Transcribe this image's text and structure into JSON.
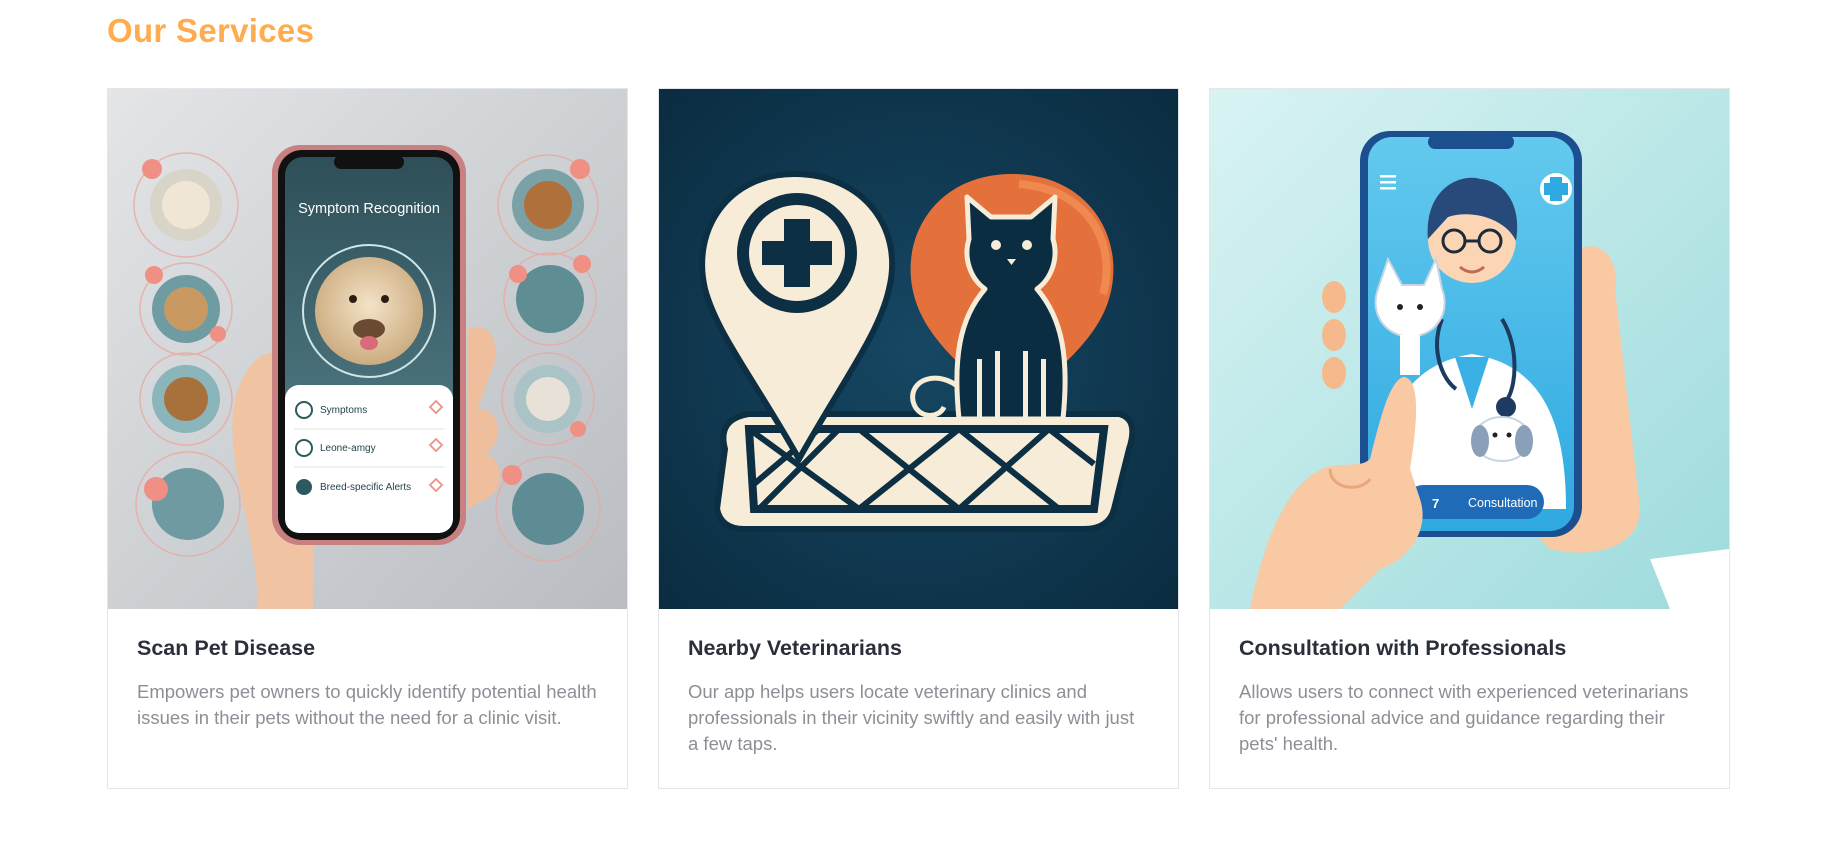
{
  "section": {
    "title": "Our Services"
  },
  "colors": {
    "accent": "#ffac4e",
    "heading": "#2b2f3a",
    "body": "#8c8f96",
    "border": "#e4e6ea"
  },
  "cards": [
    {
      "title": "Scan Pet Disease",
      "description": "Empowers pet owners to quickly identify potential health issues in their pets without the need for a clinic visit.",
      "image": {
        "screen_title": "Symptom Recognition",
        "list_items": [
          "Symptoms",
          "Leone-amgy",
          "Breed-specific Alerts"
        ]
      }
    },
    {
      "title": "Nearby Veterinarians",
      "description": "Our app helps users locate veterinary clinics and professionals in their vicinity swiftly and easily with just a few taps."
    },
    {
      "title": "Consultation with Professionals",
      "description": "Allows users to connect with experienced veterinarians for professional advice and guidance regarding their pets' health.",
      "image": {
        "button_label": "Consultation"
      }
    }
  ]
}
